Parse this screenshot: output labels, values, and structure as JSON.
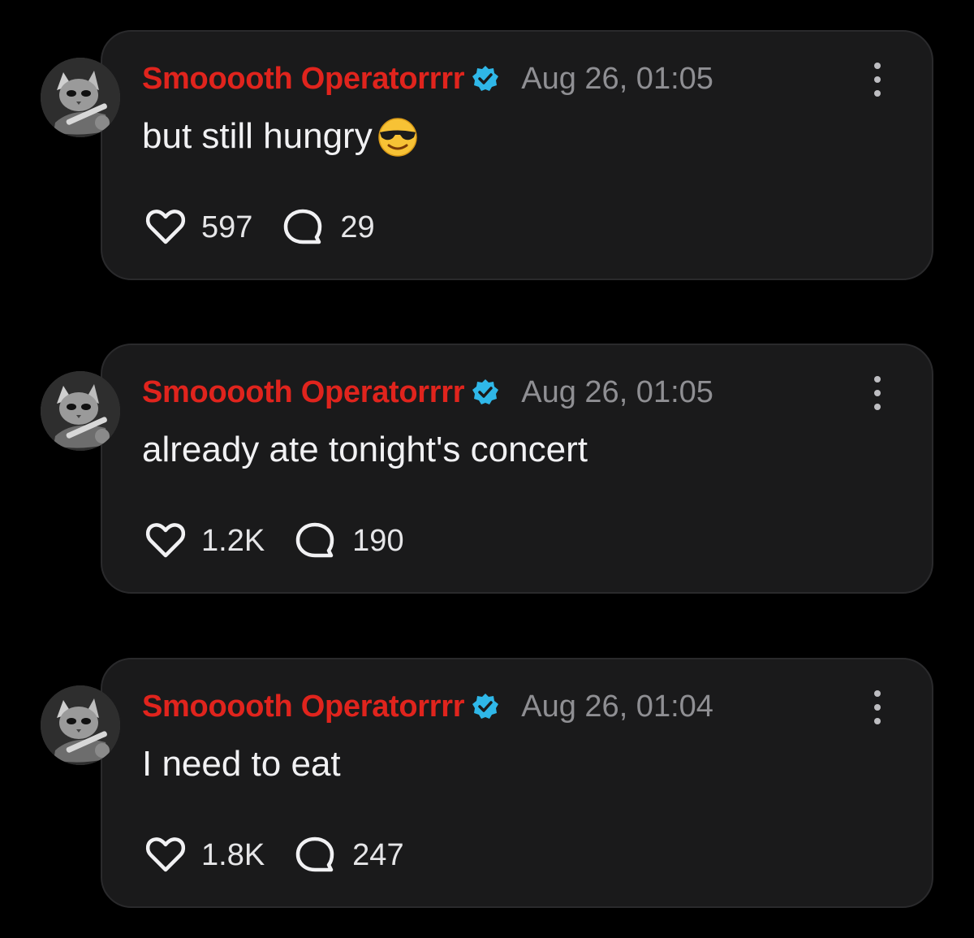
{
  "posts": [
    {
      "username": "Smooooth Operatorrrr",
      "timestamp": "Aug 26, 01:05",
      "text": "but still hungry",
      "emoji": "sunglasses-face",
      "likes": "597",
      "replies": "29"
    },
    {
      "username": "Smooooth Operatorrrr",
      "timestamp": "Aug 26, 01:05",
      "text": "already ate tonight's concert",
      "likes": "1.2K",
      "replies": "190"
    },
    {
      "username": "Smooooth Operatorrrr",
      "timestamp": "Aug 26, 01:04",
      "text": "I need to eat",
      "likes": "1.8K",
      "replies": "247"
    }
  ],
  "icons": {
    "verified": "verified-badge-icon",
    "more": "more-vertical-icon",
    "like": "heart-icon",
    "reply": "speech-bubble-icon",
    "avatar": "cat-guitar-avatar"
  },
  "colors": {
    "background": "#000000",
    "card": "#1a1a1b",
    "username": "#e0241d",
    "verified": "#2fb7e8",
    "timestamp": "#8f8f93",
    "text": "#f1f1f3"
  }
}
